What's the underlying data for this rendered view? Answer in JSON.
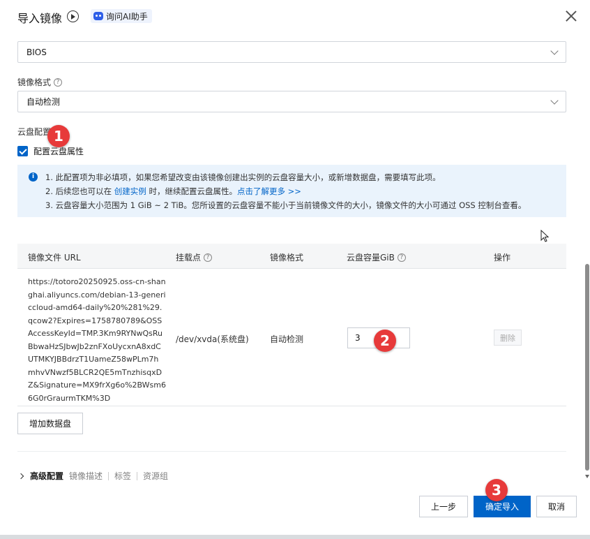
{
  "header": {
    "title": "导入镜像",
    "ai_assistant": "询问AI助手"
  },
  "boot_mode": {
    "value": "BIOS"
  },
  "image_format": {
    "label": "镜像格式",
    "value": "自动检测"
  },
  "disk_config": {
    "label": "云盘配置",
    "checkbox_label": "配置云盘属性",
    "checked": true
  },
  "info": {
    "line1": "1. 此配置项为非必填项，如果您希望改变由该镜像创建出实例的云盘容量大小，或新增数据盘，需要填写此项。",
    "line2_prefix": "2. 后续您也可以在 ",
    "line2_link1": "创建实例",
    "line2_mid": " 时，继续配置云盘属性。",
    "line2_link2": "点击了解更多 >>",
    "line3": "3. 云盘容量大小范围为 1 GiB ~ 2 TiB。您所设置的云盘容量不能小于当前镜像文件的大小，镜像文件的大小可通过 OSS 控制台查看。"
  },
  "table": {
    "columns": [
      "镜像文件 URL",
      "挂载点",
      "镜像格式",
      "云盘容量GiB",
      "操作"
    ],
    "rows": [
      {
        "url": "https://totoro20250925.oss-cn-shanghai.aliyuncs.com/debian-13-genericcloud-amd64-daily%20%281%29.qcow2?Expires=1758780789&OSSAccessKeyId=TMP.3Km9RYNwQsRuBbwaHzSJbwJb2znFXoUycxnA8xdCUTMKYJBBdrzT1UameZ58wPLm7hmhvVNwzf5BLCR2QE5mTnzhisqxDZ&Signature=MX9frXg6o%2BWsm66G0rGraurmTKM%3D",
        "mount": "/dev/xvda(系统盘)",
        "format": "自动检测",
        "capacity": "3",
        "action": "删除"
      }
    ]
  },
  "add_disk_button": "增加数据盘",
  "advanced": {
    "title": "高级配置",
    "items": [
      "镜像描述",
      "标签",
      "资源组"
    ]
  },
  "footer": {
    "prev": "上一步",
    "confirm": "确定导入",
    "cancel": "取消"
  },
  "annotations": [
    "1",
    "2",
    "3"
  ],
  "colors": {
    "primary": "#0064c8",
    "badge": "#e73a3a",
    "info_bg": "#eaf3fc"
  }
}
